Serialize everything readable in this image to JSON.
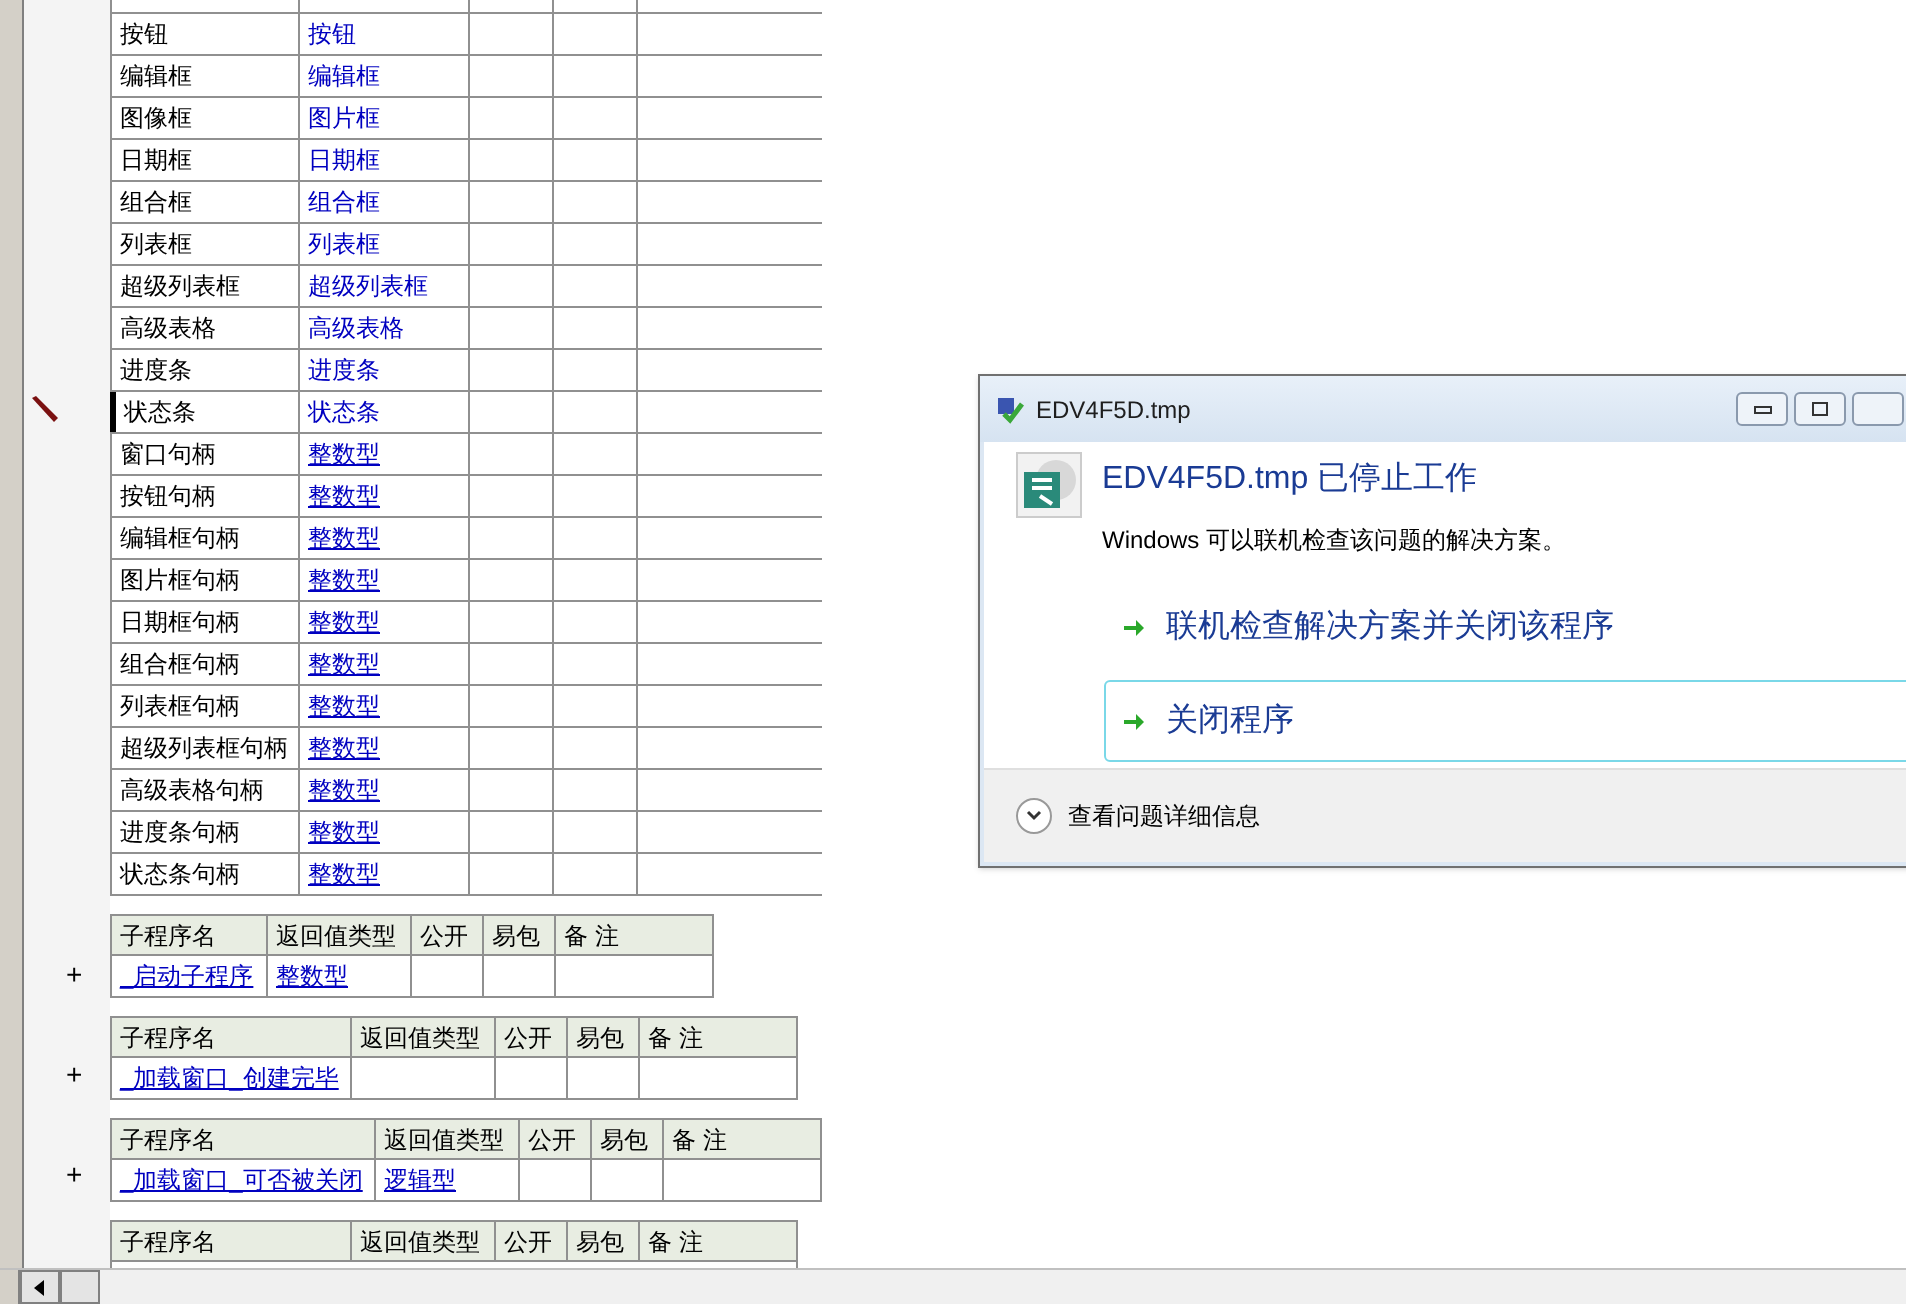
{
  "variables": [
    {
      "name": "按钮",
      "type": "按钮",
      "underlined": false,
      "cursor": false
    },
    {
      "name": "编辑框",
      "type": "编辑框",
      "underlined": false,
      "cursor": false
    },
    {
      "name": "图像框",
      "type": "图片框",
      "underlined": false,
      "cursor": false
    },
    {
      "name": "日期框",
      "type": "日期框",
      "underlined": false,
      "cursor": false
    },
    {
      "name": "组合框",
      "type": "组合框",
      "underlined": false,
      "cursor": false
    },
    {
      "name": "列表框",
      "type": "列表框",
      "underlined": false,
      "cursor": false
    },
    {
      "name": "超级列表框",
      "type": "超级列表框",
      "underlined": false,
      "cursor": false
    },
    {
      "name": "高级表格",
      "type": "高级表格",
      "underlined": false,
      "cursor": false
    },
    {
      "name": "进度条",
      "type": "进度条",
      "underlined": false,
      "cursor": false
    },
    {
      "name": "状态条",
      "type": "状态条",
      "underlined": false,
      "cursor": true
    },
    {
      "name": "窗口句柄",
      "type": "整数型",
      "underlined": true,
      "cursor": false
    },
    {
      "name": "按钮句柄",
      "type": "整数型",
      "underlined": true,
      "cursor": false
    },
    {
      "name": "编辑框句柄",
      "type": "整数型",
      "underlined": true,
      "cursor": false
    },
    {
      "name": "图片框句柄",
      "type": "整数型",
      "underlined": true,
      "cursor": false
    },
    {
      "name": "日期框句柄",
      "type": "整数型",
      "underlined": true,
      "cursor": false
    },
    {
      "name": "组合框句柄",
      "type": "整数型",
      "underlined": true,
      "cursor": false
    },
    {
      "name": "列表框句柄",
      "type": "整数型",
      "underlined": true,
      "cursor": false
    },
    {
      "name": "超级列表框句柄",
      "type": "整数型",
      "underlined": true,
      "cursor": false
    },
    {
      "name": "高级表格句柄",
      "type": "整数型",
      "underlined": true,
      "cursor": false
    },
    {
      "name": "进度条句柄",
      "type": "整数型",
      "underlined": true,
      "cursor": false
    },
    {
      "name": "状态条句柄",
      "type": "整数型",
      "underlined": true,
      "cursor": false
    }
  ],
  "subroutines": [
    {
      "headers": [
        "子程序名",
        "返回值类型",
        "公开",
        "易包",
        "备 注"
      ],
      "expander": "+",
      "name": "_启动子程序",
      "return_type": "整数型"
    },
    {
      "headers": [
        "子程序名",
        "返回值类型",
        "公开",
        "易包",
        "备 注"
      ],
      "expander": "+",
      "name": "_加载窗口_创建完毕"
    },
    {
      "headers": [
        "子程序名",
        "返回值类型",
        "公开",
        "易包",
        "备 注"
      ],
      "expander": "+",
      "name": "_加载窗口_可否被关闭",
      "return_type": "逻辑型"
    },
    {
      "headers": [
        "子程序名",
        "返回值类型",
        "公开",
        "易包",
        "备 注"
      ]
    }
  ],
  "dialog": {
    "title": "EDV4F5D.tmp",
    "heading": "EDV4F5D.tmp 已停止工作",
    "message": "Windows 可以联机检查该问题的解决方案。",
    "options": [
      {
        "label": "联机检查解决方案并关闭该程序",
        "selected": false
      },
      {
        "label": "关闭程序",
        "selected": true
      }
    ],
    "details": "查看问题详细信息"
  }
}
